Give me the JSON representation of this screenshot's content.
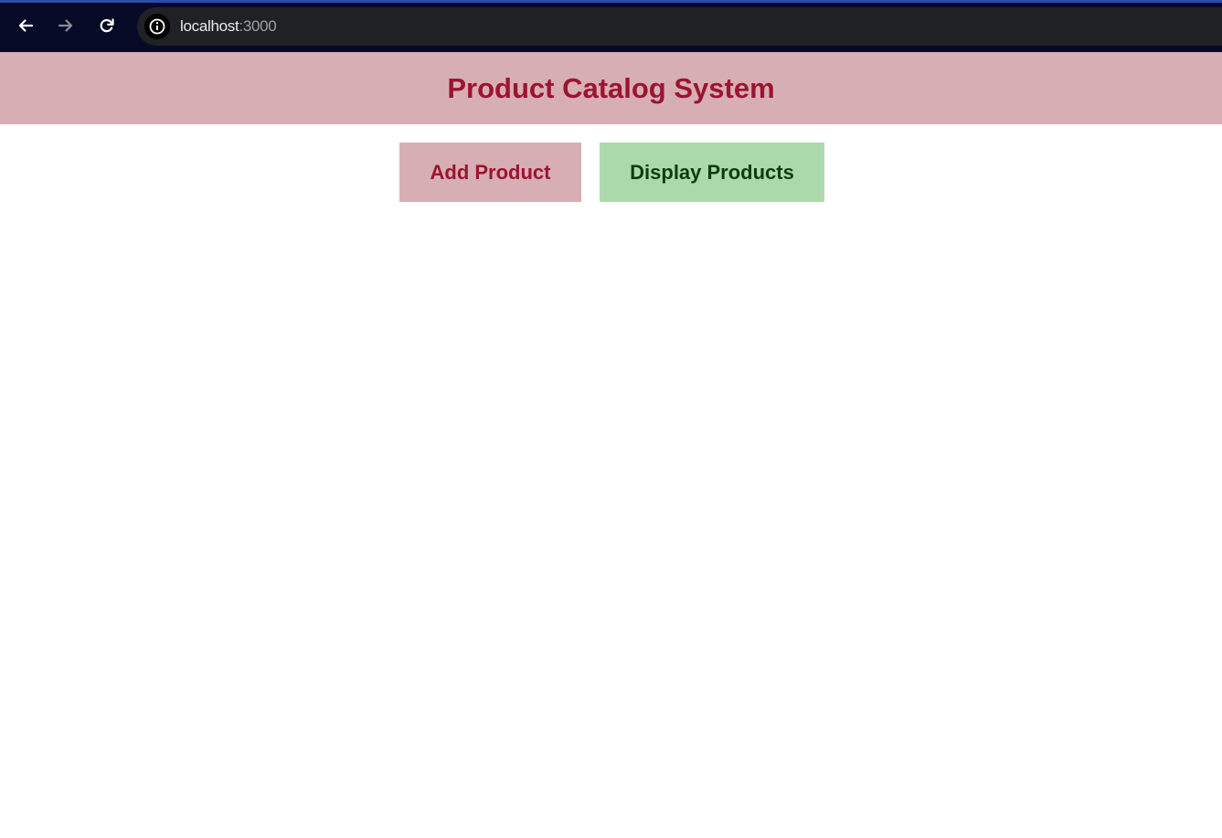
{
  "browser": {
    "url_host": "localhost",
    "url_port": ":3000",
    "back_icon": "arrow-left-icon",
    "forward_icon": "arrow-right-icon",
    "reload_icon": "reload-icon",
    "site_info_icon": "info-icon"
  },
  "header": {
    "title": "Product Catalog System"
  },
  "actions": {
    "add_label": "Add Product",
    "display_label": "Display Products"
  },
  "colors": {
    "header_bg": "#d8aeb5",
    "title_color": "#9c1430",
    "add_bg": "#d8aeb5",
    "display_bg": "#acd9ab",
    "display_text": "#0c3d10"
  }
}
